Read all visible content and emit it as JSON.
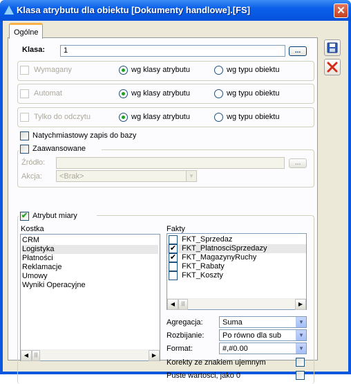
{
  "window": {
    "title": "Klasa atrybutu dla obiektu [Dokumenty handlowe].[FS]"
  },
  "tabs": [
    {
      "label": "Ogólne"
    }
  ],
  "klasa": {
    "label": "Klasa:",
    "value": "1",
    "browse": "..."
  },
  "flags": [
    {
      "label": "Wymagany",
      "opt1": "wg klasy atrybutu",
      "opt2": "wg typu obiektu",
      "selected": "opt1"
    },
    {
      "label": "Automat",
      "opt1": "wg klasy atrybutu",
      "opt2": "wg typu obiektu",
      "selected": "opt1"
    },
    {
      "label": "Tylko do odczytu",
      "opt1": "wg klasy atrybutu",
      "opt2": "wg typu obiektu",
      "selected": "opt1"
    }
  ],
  "instant": {
    "label": "Natychmiastowy zapis do bazy"
  },
  "advanced": {
    "label": "Zaawansowane",
    "source_label": "Źródło:",
    "source_value": "",
    "browse": "...",
    "action_label": "Akcja:",
    "action_value": "<Brak>"
  },
  "measure": {
    "label": "Atrybut miary",
    "kostka_label": "Kostka",
    "kostka_items": [
      "CRM",
      "Logistyka",
      "Płatności",
      "Reklamacje",
      "Umowy",
      "Wyniki Operacyjne"
    ],
    "kostka_selected": 1,
    "fakty_label": "Fakty",
    "fakty_items": [
      {
        "label": "FKT_Sprzedaz",
        "checked": false
      },
      {
        "label": "FKT_PlatnosciSprzedazy",
        "checked": true
      },
      {
        "label": "FKT_MagazynyRuchy",
        "checked": true
      },
      {
        "label": "FKT_Rabaty",
        "checked": false
      },
      {
        "label": "FKT_Koszty",
        "checked": false
      }
    ],
    "fakty_selected": 1,
    "agregacja_label": "Agregacja:",
    "agregacja_value": "Suma",
    "rozbijanie_label": "Rozbijanie:",
    "rozbijanie_value": "Po równo dla sub",
    "format_label": "Format:",
    "format_value": "#,#0.00",
    "korekty_label": "Korekty ze znakiem ujemnym",
    "puste_label": "Puste wartosci, jako 0"
  },
  "icons": {
    "save": "save-icon",
    "cancel": "cancel-icon"
  },
  "colors": {
    "titlebar": "#0a5fe8",
    "cancel": "#d42a1a",
    "check": "#21a121"
  }
}
